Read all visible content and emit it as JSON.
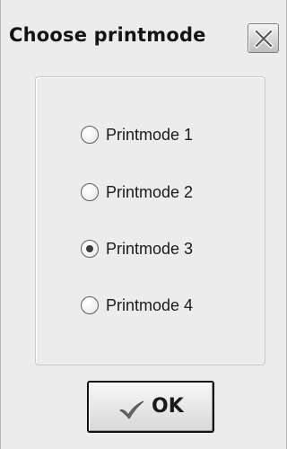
{
  "window": {
    "title": "Choose printmode"
  },
  "title_bar": {
    "close_icon": "close-icon"
  },
  "printmode_options": [
    {
      "label": "Printmode 1",
      "selected": false
    },
    {
      "label": "Printmode 2",
      "selected": false
    },
    {
      "label": "Printmode 3",
      "selected": true
    },
    {
      "label": "Printmode 4",
      "selected": false
    }
  ],
  "footer": {
    "ok_label": "OK",
    "ok_icon": "checkmark-icon"
  }
}
